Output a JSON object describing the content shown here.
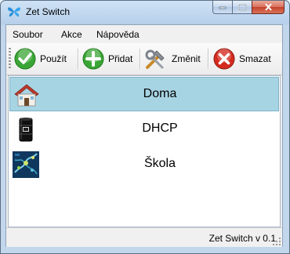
{
  "window": {
    "title": "Zet Switch",
    "app_icon": "butterfly-icon",
    "buttons": {
      "minimize_icon": "minimize-icon",
      "maximize_icon": "maximize-icon",
      "close_icon": "close-icon"
    }
  },
  "menu": [
    {
      "label": "Soubor"
    },
    {
      "label": "Akce"
    },
    {
      "label": "Nápověda"
    }
  ],
  "toolbar": [
    {
      "label": "Použít",
      "icon": "check-icon",
      "color": "#3aa535"
    },
    {
      "label": "Přidat",
      "icon": "plus-icon",
      "color": "#3aa535"
    },
    {
      "label": "Změnit",
      "icon": "tools-icon",
      "color": "#888888"
    },
    {
      "label": "Smazat",
      "icon": "delete-icon",
      "color": "#d42a1f"
    }
  ],
  "profiles": [
    {
      "name": "Doma",
      "icon": "house-icon",
      "selected": true
    },
    {
      "name": "DHCP",
      "icon": "barrel-icon",
      "selected": false
    },
    {
      "name": "Škola",
      "icon": "circuit-photo-icon",
      "selected": false
    }
  ],
  "status": {
    "text": "Zet Switch v 0.1"
  },
  "colors": {
    "selection": "#a7d4e3",
    "accent_green": "#3aa535",
    "accent_red": "#d42a1f"
  }
}
